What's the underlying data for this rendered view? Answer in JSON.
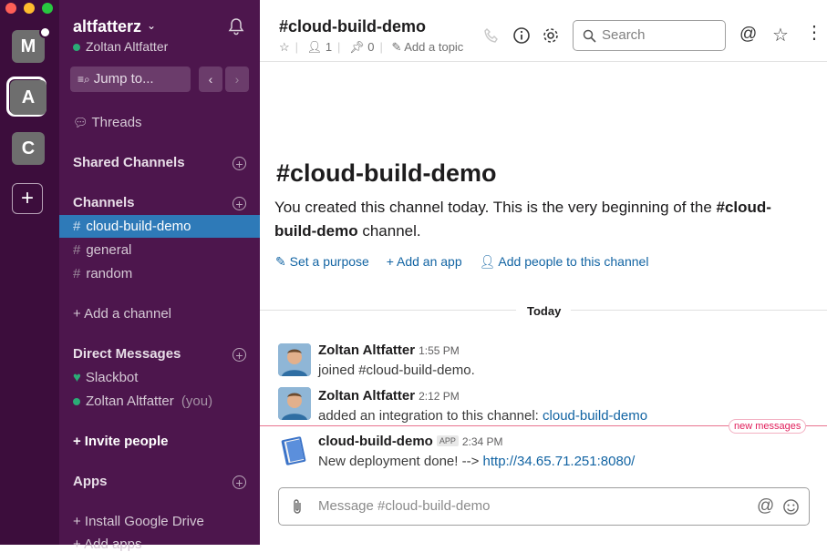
{
  "window": {
    "traffic_lights": [
      "#ff5f57",
      "#febc2e",
      "#28c840"
    ]
  },
  "team_rail": {
    "teams": [
      {
        "letter": "M"
      },
      {
        "letter": "A"
      },
      {
        "letter": "C"
      }
    ],
    "add_label": "+"
  },
  "sidebar": {
    "workspace": "altfatterz",
    "user": "Zoltan Altfatter",
    "jump_to": "Jump to...",
    "threads": "Threads",
    "shared_channels": "Shared Channels",
    "channels_header": "Channels",
    "channels": [
      "cloud-build-demo",
      "general",
      "random"
    ],
    "add_channel": "+ Add a channel",
    "dm_header": "Direct Messages",
    "dms": [
      {
        "name": "Slackbot"
      },
      {
        "name": "Zoltan Altfatter",
        "suffix": "(you)"
      }
    ],
    "invite": "Invite people",
    "apps_header": "Apps",
    "apps": [
      "+ Install Google Drive",
      "+ Add apps"
    ]
  },
  "header": {
    "title": "#cloud-build-demo",
    "members": "1",
    "pins": "0",
    "add_topic": "Add a topic",
    "search_placeholder": "Search"
  },
  "intro": {
    "title": "#cloud-build-demo",
    "text_a": "You created this channel today. This is the very beginning of the ",
    "text_b": "#cloud-build-demo",
    "text_c": " channel.",
    "set_purpose": "Set a purpose",
    "add_app": "Add an app",
    "add_people": "Add people to this channel"
  },
  "divider": "Today",
  "messages": [
    {
      "author": "Zoltan Altfatter",
      "time": "1:55 PM",
      "text": "joined #cloud-build-demo."
    },
    {
      "author": "Zoltan Altfatter",
      "time": "2:12 PM",
      "text": "added an integration to this channel: ",
      "link": "cloud-build-demo"
    },
    {
      "author": "cloud-build-demo",
      "badge": "APP",
      "time": "2:34 PM",
      "text": "New deployment done! --> ",
      "link": "http://34.65.71.251:8080/"
    }
  ],
  "new_messages": "new messages",
  "composer": {
    "placeholder": "Message #cloud-build-demo"
  },
  "colors": {
    "sidebar": "#4d164d",
    "rail": "#3c0d3c",
    "active": "#2e7ab8",
    "link": "#1264a3",
    "presence": "#2bac76"
  }
}
